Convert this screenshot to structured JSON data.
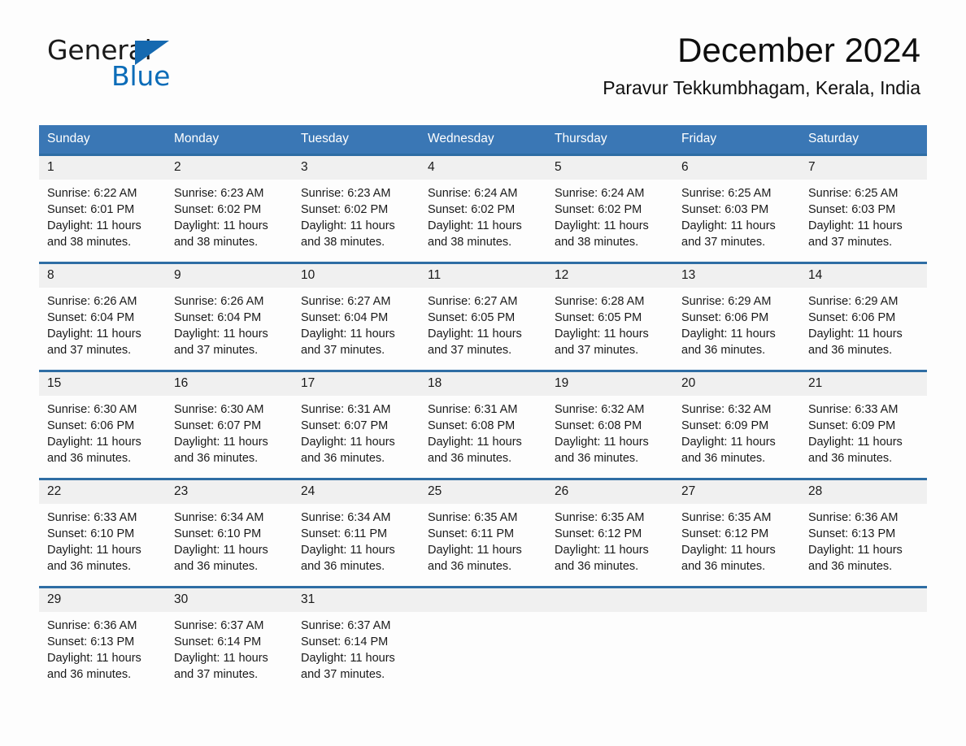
{
  "brand": {
    "name_part1": "General",
    "name_part2": "Blue",
    "triangle_color": "#1569b0",
    "blue_color": "#0b6cb8"
  },
  "header": {
    "month_title": "December 2024",
    "location": "Paravur Tekkumbhagam, Kerala, India"
  },
  "theme": {
    "header_bar": "#3a77b5",
    "week_rule": "#2e6da4",
    "daynum_band": "#f0f0f0",
    "page_bg": "#fdfdfd"
  },
  "calendar": {
    "weekday_headers": [
      "Sunday",
      "Monday",
      "Tuesday",
      "Wednesday",
      "Thursday",
      "Friday",
      "Saturday"
    ],
    "weeks": [
      [
        {
          "day": "1",
          "sunrise": "Sunrise: 6:22 AM",
          "sunset": "Sunset: 6:01 PM",
          "daylight_line1": "Daylight: 11 hours",
          "daylight_line2": "and 38 minutes."
        },
        {
          "day": "2",
          "sunrise": "Sunrise: 6:23 AM",
          "sunset": "Sunset: 6:02 PM",
          "daylight_line1": "Daylight: 11 hours",
          "daylight_line2": "and 38 minutes."
        },
        {
          "day": "3",
          "sunrise": "Sunrise: 6:23 AM",
          "sunset": "Sunset: 6:02 PM",
          "daylight_line1": "Daylight: 11 hours",
          "daylight_line2": "and 38 minutes."
        },
        {
          "day": "4",
          "sunrise": "Sunrise: 6:24 AM",
          "sunset": "Sunset: 6:02 PM",
          "daylight_line1": "Daylight: 11 hours",
          "daylight_line2": "and 38 minutes."
        },
        {
          "day": "5",
          "sunrise": "Sunrise: 6:24 AM",
          "sunset": "Sunset: 6:02 PM",
          "daylight_line1": "Daylight: 11 hours",
          "daylight_line2": "and 38 minutes."
        },
        {
          "day": "6",
          "sunrise": "Sunrise: 6:25 AM",
          "sunset": "Sunset: 6:03 PM",
          "daylight_line1": "Daylight: 11 hours",
          "daylight_line2": "and 37 minutes."
        },
        {
          "day": "7",
          "sunrise": "Sunrise: 6:25 AM",
          "sunset": "Sunset: 6:03 PM",
          "daylight_line1": "Daylight: 11 hours",
          "daylight_line2": "and 37 minutes."
        }
      ],
      [
        {
          "day": "8",
          "sunrise": "Sunrise: 6:26 AM",
          "sunset": "Sunset: 6:04 PM",
          "daylight_line1": "Daylight: 11 hours",
          "daylight_line2": "and 37 minutes."
        },
        {
          "day": "9",
          "sunrise": "Sunrise: 6:26 AM",
          "sunset": "Sunset: 6:04 PM",
          "daylight_line1": "Daylight: 11 hours",
          "daylight_line2": "and 37 minutes."
        },
        {
          "day": "10",
          "sunrise": "Sunrise: 6:27 AM",
          "sunset": "Sunset: 6:04 PM",
          "daylight_line1": "Daylight: 11 hours",
          "daylight_line2": "and 37 minutes."
        },
        {
          "day": "11",
          "sunrise": "Sunrise: 6:27 AM",
          "sunset": "Sunset: 6:05 PM",
          "daylight_line1": "Daylight: 11 hours",
          "daylight_line2": "and 37 minutes."
        },
        {
          "day": "12",
          "sunrise": "Sunrise: 6:28 AM",
          "sunset": "Sunset: 6:05 PM",
          "daylight_line1": "Daylight: 11 hours",
          "daylight_line2": "and 37 minutes."
        },
        {
          "day": "13",
          "sunrise": "Sunrise: 6:29 AM",
          "sunset": "Sunset: 6:06 PM",
          "daylight_line1": "Daylight: 11 hours",
          "daylight_line2": "and 36 minutes."
        },
        {
          "day": "14",
          "sunrise": "Sunrise: 6:29 AM",
          "sunset": "Sunset: 6:06 PM",
          "daylight_line1": "Daylight: 11 hours",
          "daylight_line2": "and 36 minutes."
        }
      ],
      [
        {
          "day": "15",
          "sunrise": "Sunrise: 6:30 AM",
          "sunset": "Sunset: 6:06 PM",
          "daylight_line1": "Daylight: 11 hours",
          "daylight_line2": "and 36 minutes."
        },
        {
          "day": "16",
          "sunrise": "Sunrise: 6:30 AM",
          "sunset": "Sunset: 6:07 PM",
          "daylight_line1": "Daylight: 11 hours",
          "daylight_line2": "and 36 minutes."
        },
        {
          "day": "17",
          "sunrise": "Sunrise: 6:31 AM",
          "sunset": "Sunset: 6:07 PM",
          "daylight_line1": "Daylight: 11 hours",
          "daylight_line2": "and 36 minutes."
        },
        {
          "day": "18",
          "sunrise": "Sunrise: 6:31 AM",
          "sunset": "Sunset: 6:08 PM",
          "daylight_line1": "Daylight: 11 hours",
          "daylight_line2": "and 36 minutes."
        },
        {
          "day": "19",
          "sunrise": "Sunrise: 6:32 AM",
          "sunset": "Sunset: 6:08 PM",
          "daylight_line1": "Daylight: 11 hours",
          "daylight_line2": "and 36 minutes."
        },
        {
          "day": "20",
          "sunrise": "Sunrise: 6:32 AM",
          "sunset": "Sunset: 6:09 PM",
          "daylight_line1": "Daylight: 11 hours",
          "daylight_line2": "and 36 minutes."
        },
        {
          "day": "21",
          "sunrise": "Sunrise: 6:33 AM",
          "sunset": "Sunset: 6:09 PM",
          "daylight_line1": "Daylight: 11 hours",
          "daylight_line2": "and 36 minutes."
        }
      ],
      [
        {
          "day": "22",
          "sunrise": "Sunrise: 6:33 AM",
          "sunset": "Sunset: 6:10 PM",
          "daylight_line1": "Daylight: 11 hours",
          "daylight_line2": "and 36 minutes."
        },
        {
          "day": "23",
          "sunrise": "Sunrise: 6:34 AM",
          "sunset": "Sunset: 6:10 PM",
          "daylight_line1": "Daylight: 11 hours",
          "daylight_line2": "and 36 minutes."
        },
        {
          "day": "24",
          "sunrise": "Sunrise: 6:34 AM",
          "sunset": "Sunset: 6:11 PM",
          "daylight_line1": "Daylight: 11 hours",
          "daylight_line2": "and 36 minutes."
        },
        {
          "day": "25",
          "sunrise": "Sunrise: 6:35 AM",
          "sunset": "Sunset: 6:11 PM",
          "daylight_line1": "Daylight: 11 hours",
          "daylight_line2": "and 36 minutes."
        },
        {
          "day": "26",
          "sunrise": "Sunrise: 6:35 AM",
          "sunset": "Sunset: 6:12 PM",
          "daylight_line1": "Daylight: 11 hours",
          "daylight_line2": "and 36 minutes."
        },
        {
          "day": "27",
          "sunrise": "Sunrise: 6:35 AM",
          "sunset": "Sunset: 6:12 PM",
          "daylight_line1": "Daylight: 11 hours",
          "daylight_line2": "and 36 minutes."
        },
        {
          "day": "28",
          "sunrise": "Sunrise: 6:36 AM",
          "sunset": "Sunset: 6:13 PM",
          "daylight_line1": "Daylight: 11 hours",
          "daylight_line2": "and 36 minutes."
        }
      ],
      [
        {
          "day": "29",
          "sunrise": "Sunrise: 6:36 AM",
          "sunset": "Sunset: 6:13 PM",
          "daylight_line1": "Daylight: 11 hours",
          "daylight_line2": "and 36 minutes."
        },
        {
          "day": "30",
          "sunrise": "Sunrise: 6:37 AM",
          "sunset": "Sunset: 6:14 PM",
          "daylight_line1": "Daylight: 11 hours",
          "daylight_line2": "and 37 minutes."
        },
        {
          "day": "31",
          "sunrise": "Sunrise: 6:37 AM",
          "sunset": "Sunset: 6:14 PM",
          "daylight_line1": "Daylight: 11 hours",
          "daylight_line2": "and 37 minutes."
        },
        {
          "day": "",
          "sunrise": "",
          "sunset": "",
          "daylight_line1": "",
          "daylight_line2": ""
        },
        {
          "day": "",
          "sunrise": "",
          "sunset": "",
          "daylight_line1": "",
          "daylight_line2": ""
        },
        {
          "day": "",
          "sunrise": "",
          "sunset": "",
          "daylight_line1": "",
          "daylight_line2": ""
        },
        {
          "day": "",
          "sunrise": "",
          "sunset": "",
          "daylight_line1": "",
          "daylight_line2": ""
        }
      ]
    ]
  }
}
